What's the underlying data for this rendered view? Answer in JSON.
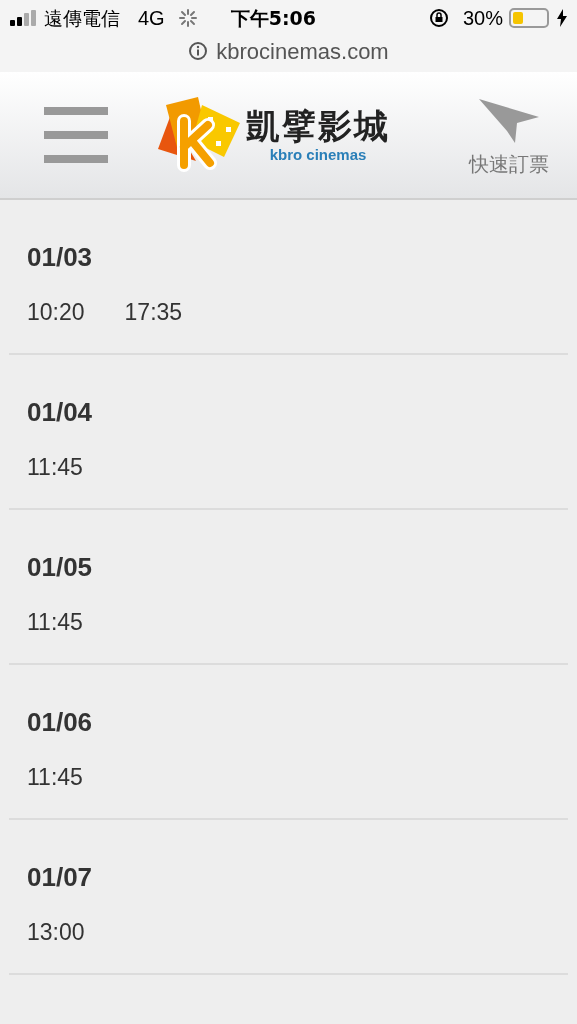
{
  "status_bar": {
    "carrier": "遠傳電信",
    "network": "4G",
    "time": "下午5:06",
    "battery_percent": "30%"
  },
  "address_bar": {
    "url": "kbrocinemas.com"
  },
  "header": {
    "logo_title": "凱擘影城",
    "logo_subtitle": "kbro cinemas",
    "quick_booking": "快速訂票"
  },
  "showtimes": [
    {
      "date": "01/03",
      "times": [
        "10:20",
        "17:35"
      ]
    },
    {
      "date": "01/04",
      "times": [
        "11:45"
      ]
    },
    {
      "date": "01/05",
      "times": [
        "11:45"
      ]
    },
    {
      "date": "01/06",
      "times": [
        "11:45"
      ]
    },
    {
      "date": "01/07",
      "times": [
        "13:00"
      ]
    }
  ]
}
